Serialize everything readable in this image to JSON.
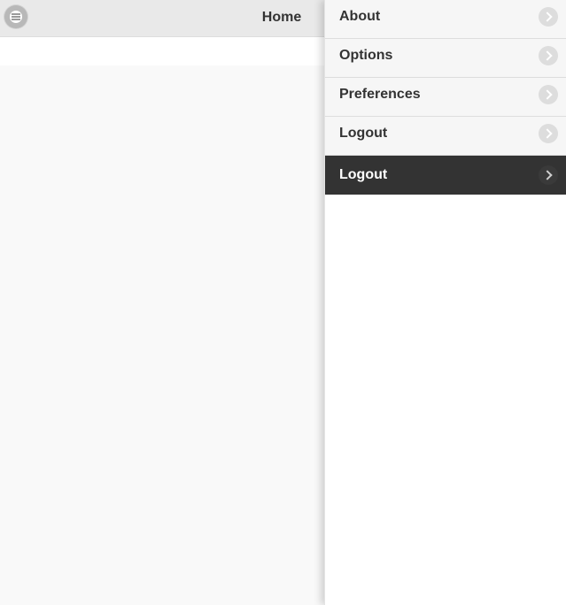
{
  "header": {
    "title": "Home",
    "menu_icon": "hamburger-icon"
  },
  "menu_panel": {
    "items": [
      {
        "label": "About",
        "icon": "chevron-right-icon",
        "active": false
      },
      {
        "label": "Options",
        "icon": "chevron-right-icon",
        "active": false
      },
      {
        "label": "Preferences",
        "icon": "chevron-right-icon",
        "active": false
      },
      {
        "label": "Logout",
        "icon": "chevron-right-icon",
        "active": false
      },
      {
        "label": "Logout",
        "icon": "chevron-right-icon",
        "active": true
      }
    ]
  },
  "colors": {
    "header_bg": "#e9e9e9",
    "page_bg": "#f9f9f9",
    "menu_item_bg": "#f6f6f6",
    "active_item_bg": "#333333",
    "text": "#333333",
    "active_text": "#ffffff"
  }
}
